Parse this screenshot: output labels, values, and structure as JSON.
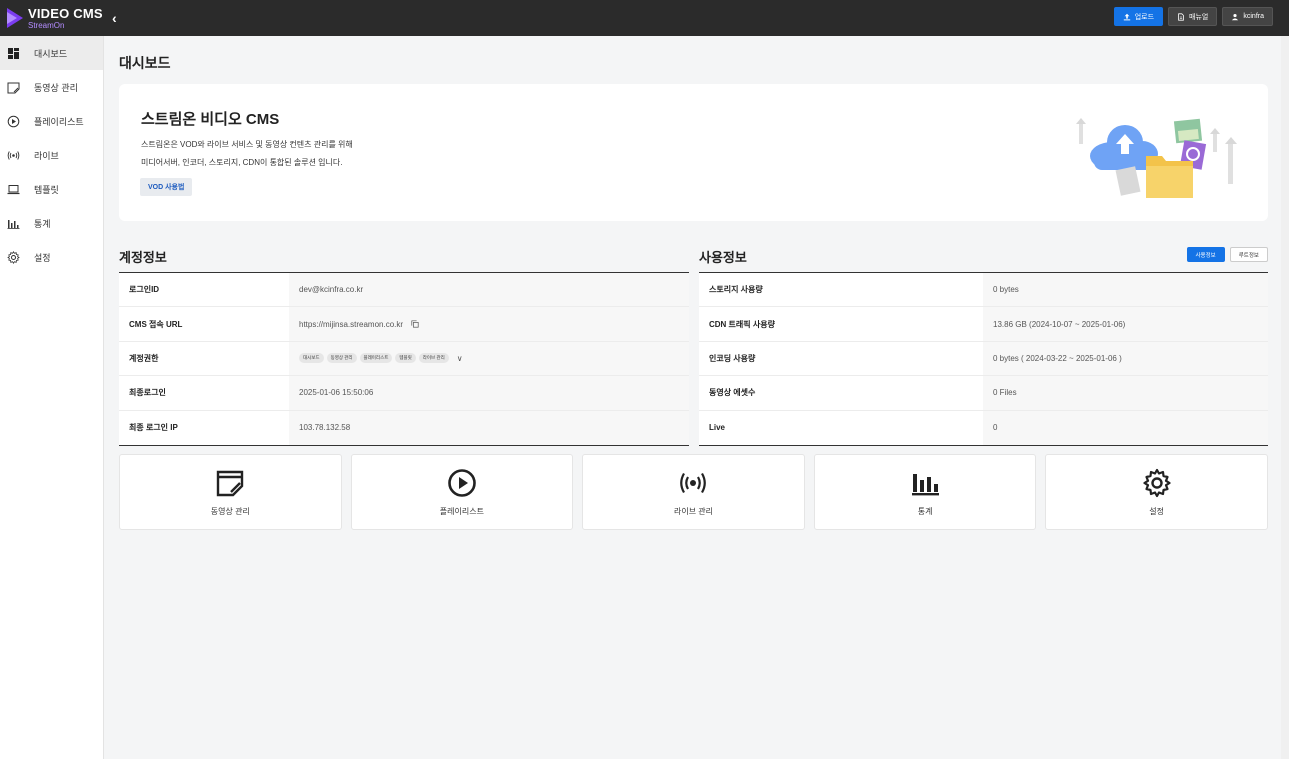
{
  "header": {
    "logo_title": "VIDEO CMS",
    "logo_sub": "StreamOn",
    "upload_label": "업로드",
    "manual_label": "매뉴얼",
    "user_label": "kcinfra"
  },
  "sidebar": {
    "items": [
      {
        "label": "대시보드",
        "icon": "dashboard-icon"
      },
      {
        "label": "동영상 관리",
        "icon": "video-manage-icon"
      },
      {
        "label": "플레이리스트",
        "icon": "playlist-icon"
      },
      {
        "label": "라이브",
        "icon": "live-icon"
      },
      {
        "label": "템플릿",
        "icon": "template-icon"
      },
      {
        "label": "통계",
        "icon": "stats-icon"
      },
      {
        "label": "설정",
        "icon": "settings-icon"
      }
    ]
  },
  "page": {
    "title": "대시보드"
  },
  "hero": {
    "title": "스트림온 비디오 CMS",
    "desc_line1": "스트림온은 VOD와 라이브 서비스 및 동영상 컨텐츠 관리를 위해",
    "desc_line2": "미디어서버, 인코더, 스토리지, CDN이 통합된 솔루션 입니다.",
    "button_label": "VOD 사용법"
  },
  "account": {
    "title": "계정정보",
    "rows": [
      {
        "key": "로그인ID",
        "value": "dev@kcinfra.co.kr"
      },
      {
        "key": "CMS 접속 URL",
        "value": "https://mijinsa.streamon.co.kr"
      },
      {
        "key": "계정권한",
        "value": ""
      },
      {
        "key": "최종로그인",
        "value": "2025-01-06 15:50:06"
      },
      {
        "key": "최종 로그인 IP",
        "value": "103.78.132.58"
      }
    ],
    "permissions": [
      "대시보드",
      "동영상 관리",
      "플레이리스트",
      "템플릿",
      "라이브 관리"
    ]
  },
  "usage": {
    "title": "사용정보",
    "tab_usage": "사용정보",
    "tab_route": "루트정보",
    "rows": [
      {
        "key": "스토리지 사용량",
        "value": "0 bytes"
      },
      {
        "key": "CDN 트래픽 사용량",
        "value": "13.86 GB (2024-10-07 ~ 2025-01-06)"
      },
      {
        "key": "인코딩 사용량",
        "value": "0 bytes ( 2024-03-22 ~ 2025-01-06 )"
      },
      {
        "key": "동영상 에셋수",
        "value": "0 Files"
      },
      {
        "key": "Live",
        "value": "0"
      }
    ]
  },
  "shortcuts": [
    {
      "label": "동영상 관리",
      "icon": "video-manage-icon"
    },
    {
      "label": "플레이리스트",
      "icon": "playlist-icon"
    },
    {
      "label": "라이브 관리",
      "icon": "live-icon"
    },
    {
      "label": "통계",
      "icon": "stats-icon"
    },
    {
      "label": "설정",
      "icon": "settings-icon"
    }
  ],
  "colors": {
    "accent": "#1473e6",
    "topbar": "#2b2b2b",
    "logo_purple": "#7b3cf0"
  }
}
